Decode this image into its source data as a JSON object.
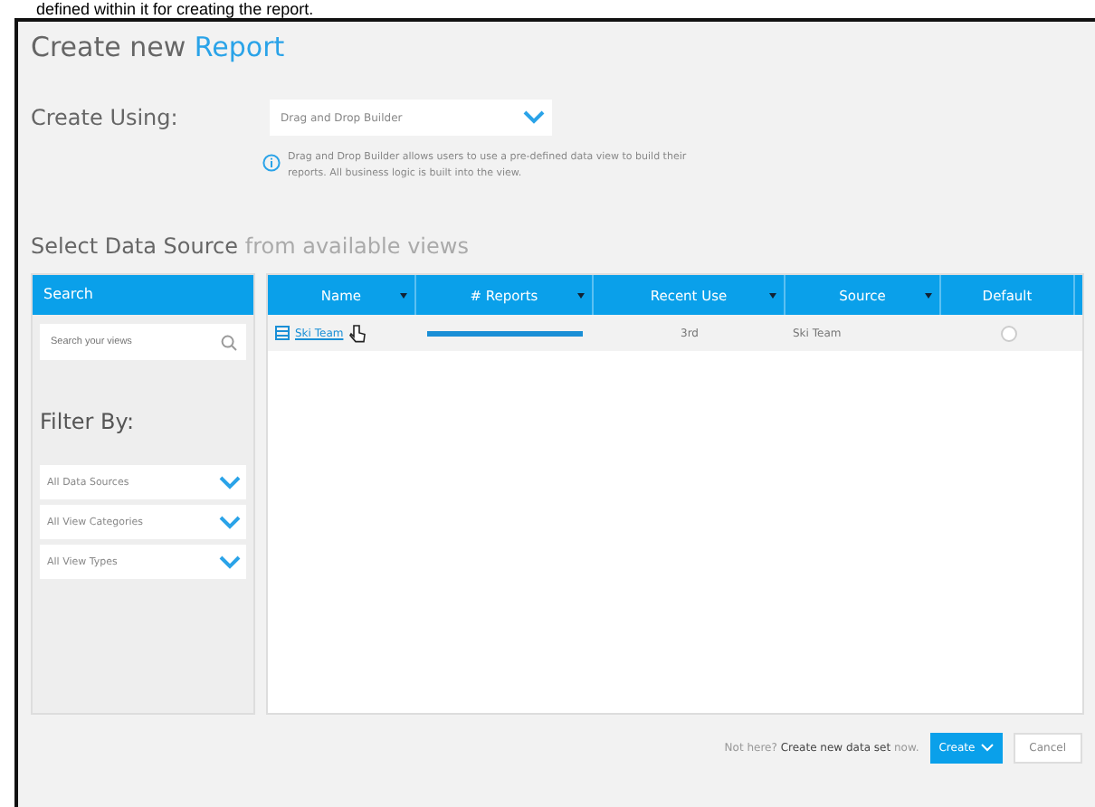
{
  "caption": "defined within it for creating the report.",
  "title": {
    "prefix": "Create new",
    "highlight": "Report"
  },
  "create_using": {
    "label": "Create Using:",
    "value": "Drag and Drop Builder",
    "info": "Drag and Drop Builder allows users to use a pre-defined data view to build their reports. All business logic is built into the view."
  },
  "section": {
    "title": "Select Data Source",
    "subtitle": "from available views"
  },
  "sidebar": {
    "header": "Search",
    "search": {
      "placeholder": "Search your views"
    },
    "filter_label": "Filter By:",
    "filters": [
      "All Data Sources",
      "All View Categories",
      "All View Types"
    ]
  },
  "table": {
    "columns": [
      {
        "label": "Name",
        "sortable": true
      },
      {
        "label": "# Reports",
        "sortable": true
      },
      {
        "label": "Recent Use",
        "sortable": true
      },
      {
        "label": "Source",
        "sortable": true
      },
      {
        "label": "Default",
        "sortable": false
      }
    ],
    "rows": [
      {
        "name": "Ski Team",
        "recent_use": "3rd",
        "source": "Ski Team",
        "selected": false
      }
    ]
  },
  "footer": {
    "prompt": "Not here?",
    "link": "Create new data set",
    "suffix": "now.",
    "buttons": [
      {
        "label": "Create",
        "kind": "primary"
      },
      {
        "label": "Cancel",
        "kind": "secondary"
      }
    ]
  }
}
